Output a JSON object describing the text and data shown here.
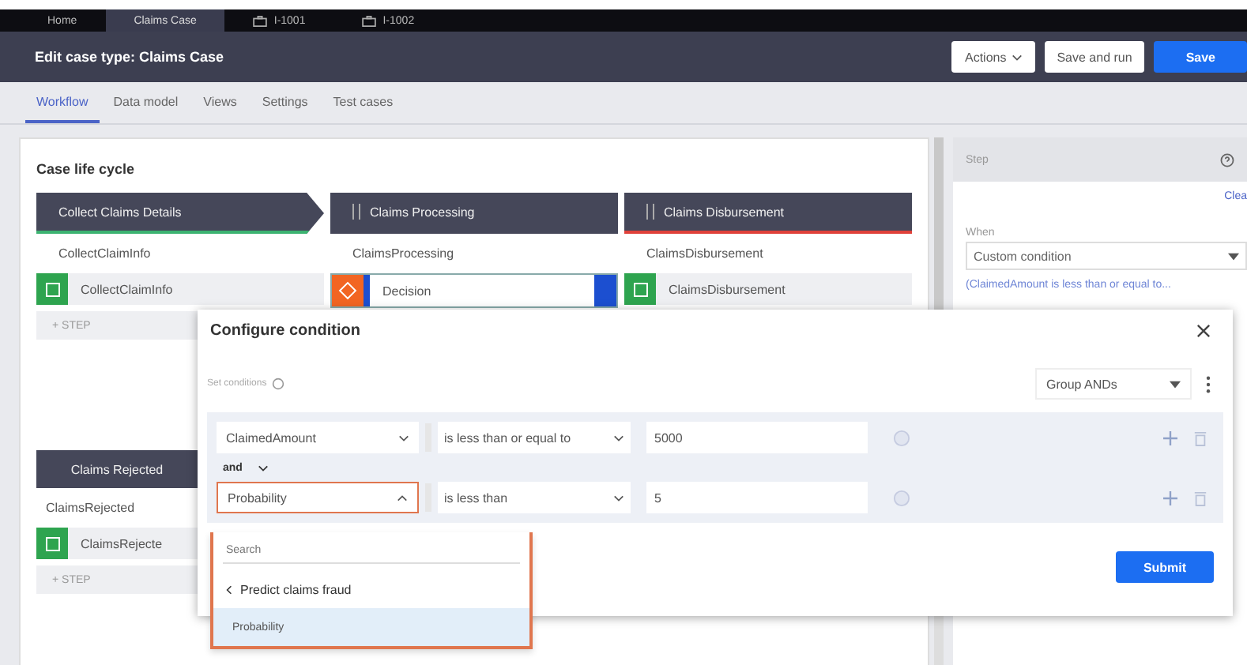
{
  "top_tabs": [
    {
      "label": "Home",
      "kind": "page",
      "selected": false
    },
    {
      "label": "Claims Case",
      "kind": "page",
      "selected": true
    },
    {
      "label": "I-1001",
      "kind": "work",
      "selected": false
    },
    {
      "label": "I-1002",
      "kind": "work",
      "selected": false
    }
  ],
  "header": {
    "title": "Edit case type: Claims Case",
    "buttons": [
      {
        "label": "Actions",
        "kind": "menu"
      },
      {
        "label": "Save and run",
        "kind": "secondary"
      },
      {
        "label": "Save",
        "kind": "primary"
      }
    ]
  },
  "tabs": [
    {
      "label": "Workflow",
      "selected": true
    },
    {
      "label": "Data model",
      "selected": false
    },
    {
      "label": "Views",
      "selected": false
    },
    {
      "label": "Settings",
      "selected": false
    },
    {
      "label": "Test cases",
      "selected": false
    }
  ],
  "life_cycle": {
    "title": "Case life cycle",
    "stages": [
      {
        "name": "Collect Claims Details",
        "color": "#3cb371",
        "process": "CollectClaimInfo",
        "step": {
          "label": "CollectClaimInfo",
          "kind": "assignment"
        },
        "add_step": "+ STEP"
      },
      {
        "name": "Claims Processing",
        "color": "#454759",
        "process": "ClaimsProcessing",
        "step": {
          "label": "Decision",
          "kind": "decision"
        }
      },
      {
        "name": "Claims Disbursement",
        "color": "#e0413a",
        "process": "ClaimsDisbursement",
        "step": {
          "label": "ClaimsDisbursement",
          "kind": "assignment"
        }
      }
    ],
    "alternate_stages": [
      {
        "name": "Claims Rejected",
        "process": "ClaimsRejected",
        "step": {
          "label": "ClaimsRejecte",
          "kind": "assignment"
        },
        "add_step": "+ STEP"
      }
    ]
  },
  "step_panel": {
    "title": "Step",
    "clear_link": "Clea",
    "when_label": "When",
    "when_value": "Custom condition",
    "condition_link": "(ClaimedAmount is less than or equal to..."
  },
  "dialog": {
    "title": "Configure condition",
    "set_conditions": "Set conditions",
    "group_mode": "Group ANDs",
    "joiner": "and",
    "submit": "Submit",
    "conditions": [
      {
        "field": "ClaimedAmount",
        "operator": "is less than or equal to",
        "value": "5000",
        "expanded": false
      },
      {
        "field": "Probability",
        "operator": "is less than",
        "value": "5",
        "expanded": true
      }
    ],
    "field_menu": {
      "search_placeholder": "Search",
      "back": "Predict claims fraud",
      "items": [
        {
          "label": "Probability",
          "selected": true
        }
      ]
    }
  }
}
